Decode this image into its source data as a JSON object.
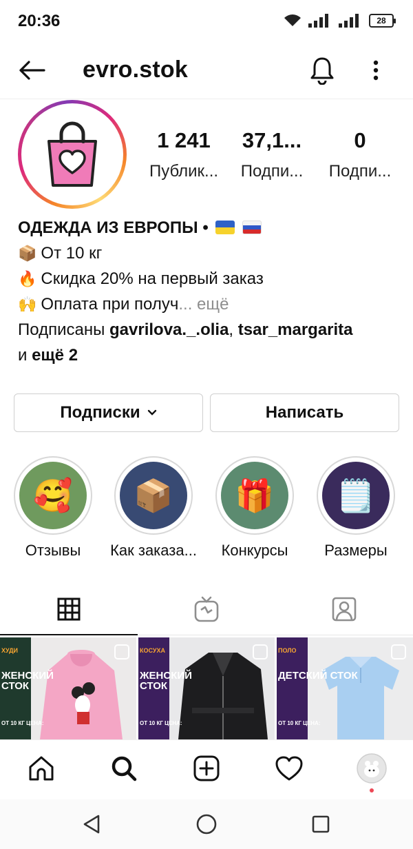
{
  "status": {
    "time": "20:36",
    "battery": "28"
  },
  "header": {
    "username": "evro.stok"
  },
  "stats": [
    {
      "value": "1 241",
      "label": "Публик..."
    },
    {
      "value": "37,1...",
      "label": "Подпи..."
    },
    {
      "value": "0",
      "label": "Подпи..."
    }
  ],
  "bio": {
    "name": "ОДЕЖДА ИЗ ЕВРОПЫ •",
    "line1": "От 10 кг",
    "line2": "Скидка 20% на первый заказ",
    "line3": "Оплата при получ",
    "more": "... ещё",
    "followed_prefix": "Подписаны",
    "followed_user1": "gavrilova._.olia",
    "followed_sep": ",",
    "followed_user2": "tsar_margarita",
    "followed_and": "и",
    "followed_more": "ещё 2"
  },
  "buttons": {
    "following": "Подписки",
    "message": "Написать"
  },
  "highlights": [
    {
      "label": "Отзывы",
      "emoji": "🥰",
      "color": "#6f9a5e"
    },
    {
      "label": "Как заказа...",
      "emoji": "📦",
      "color": "#384a73"
    },
    {
      "label": "Конкурсы",
      "emoji": "🎁",
      "color": "#5c8b70"
    },
    {
      "label": "Размеры",
      "emoji": "🗒️",
      "color": "#3a2b5c"
    }
  ],
  "posts": [
    {
      "tag": "ХУДИ",
      "title": "ЖЕНСКИЙ СТОК",
      "sub": "ОТ 10 КГ ЦЕНА:",
      "bg": "#1f3a2d",
      "photo": "#f4a6c5"
    },
    {
      "tag": "КОСУХА",
      "title": "ЖЕНСКИЙ СТОК",
      "sub": "ОТ 10 КГ ЦЕНА:",
      "bg": "#3c1f5e",
      "photo": "#1d1d1f"
    },
    {
      "tag": "ПОЛО",
      "title": "ДЕТСКИЙ СТОК",
      "sub": "ОТ 10 КГ ЦЕНА:",
      "bg": "#3c1f5e",
      "photo": "#a9cff1"
    }
  ]
}
